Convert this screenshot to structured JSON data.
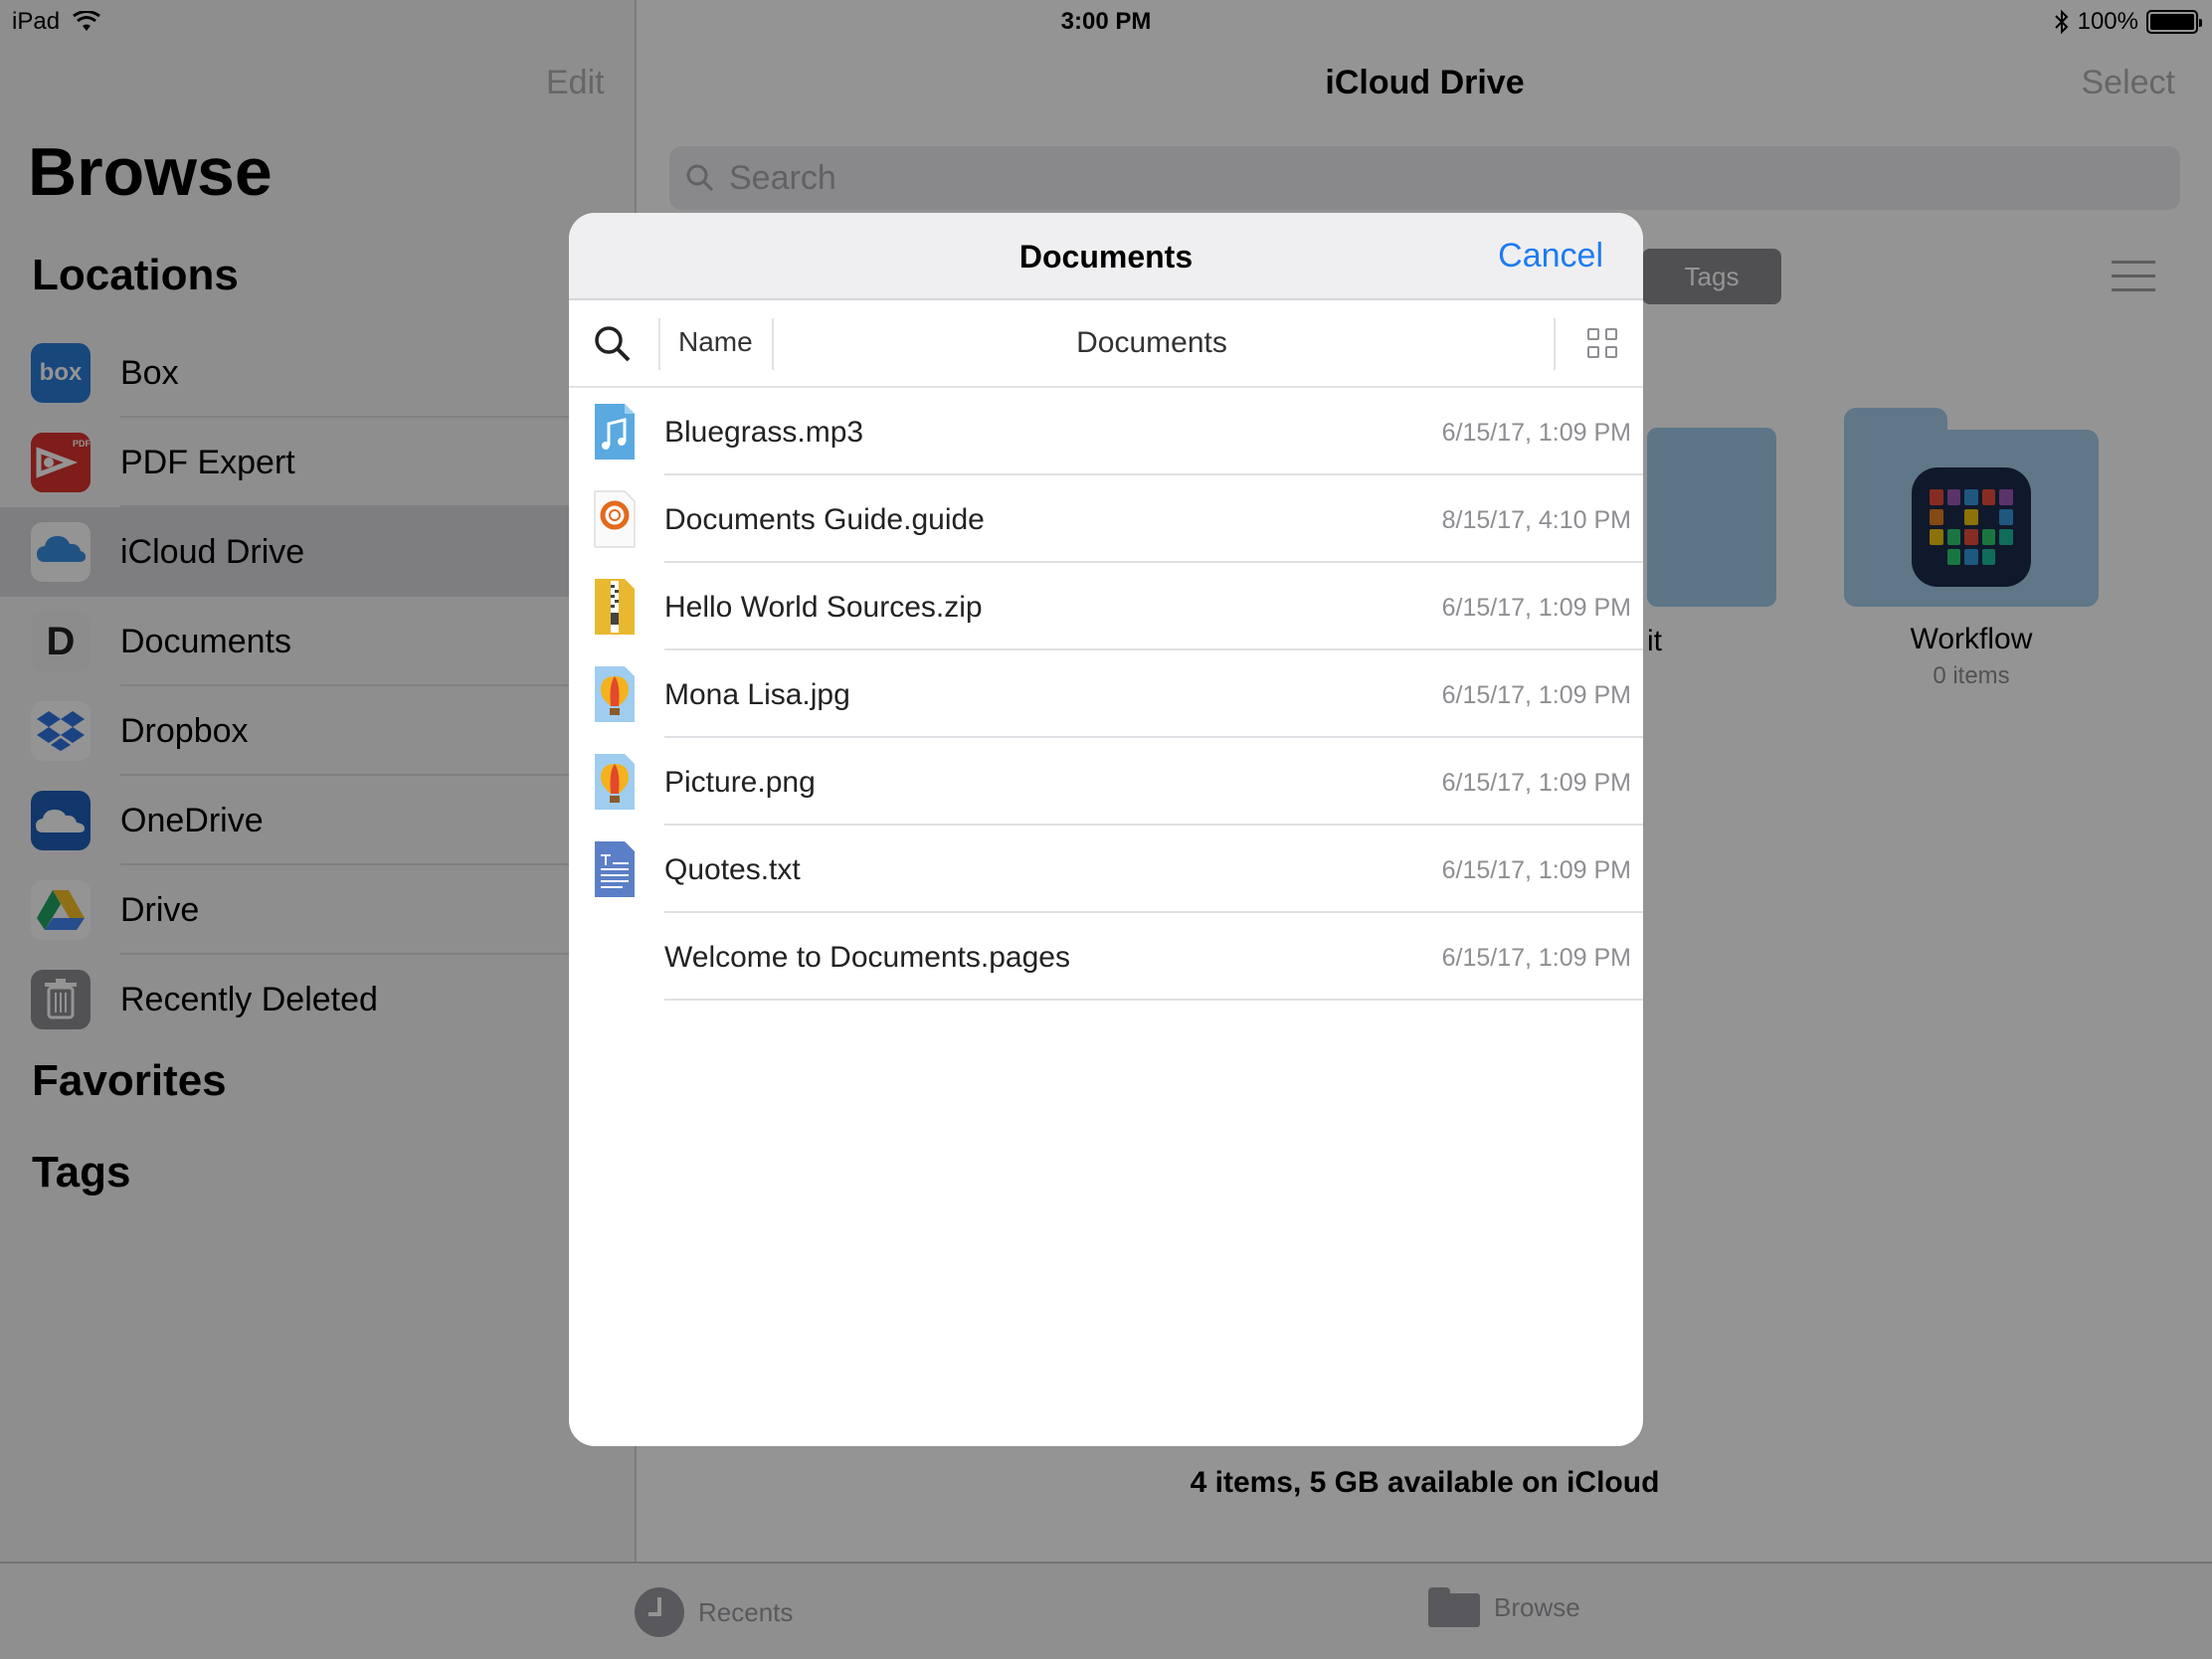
{
  "status_bar": {
    "device": "iPad",
    "time": "3:00 PM",
    "battery": "100%"
  },
  "sidebar": {
    "edit_label": "Edit",
    "title": "Browse",
    "locations_heading": "Locations",
    "locations": [
      {
        "label": "Box",
        "icon": "box-icon",
        "icon_text": "box",
        "color": "#2a7ad6"
      },
      {
        "label": "PDF Expert",
        "icon": "pdf-expert-icon",
        "icon_text": "PDF",
        "color": "#d9322c"
      },
      {
        "label": "iCloud Drive",
        "icon": "icloud-icon",
        "icon_text": "",
        "color": "#ffffff",
        "selected": true
      },
      {
        "label": "Documents",
        "icon": "documents-app-icon",
        "icon_text": "D",
        "color": "#ffffff"
      },
      {
        "label": "Dropbox",
        "icon": "dropbox-icon",
        "icon_text": "",
        "color": "#ffffff"
      },
      {
        "label": "OneDrive",
        "icon": "onedrive-icon",
        "icon_text": "",
        "color": "#1f60b8"
      },
      {
        "label": "Drive",
        "icon": "google-drive-icon",
        "icon_text": "",
        "color": "#ffffff"
      },
      {
        "label": "Recently Deleted",
        "icon": "trash-icon",
        "icon_text": "",
        "color": "#8e8e93"
      }
    ],
    "favorites_heading": "Favorites",
    "tags_heading": "Tags"
  },
  "main": {
    "title": "iCloud Drive",
    "select_label": "Select",
    "search_placeholder": "Search",
    "tags_chip": "Tags",
    "partial_folder_label": "it",
    "folder": {
      "name": "Workflow",
      "count": "0 items"
    },
    "storage_text": "4 items, 5 GB available on iCloud"
  },
  "tab_bar": {
    "recents_label": "Recents",
    "browse_label": "Browse"
  },
  "modal": {
    "title": "Documents",
    "cancel_label": "Cancel",
    "sort_label": "Name",
    "path_label": "Documents",
    "files": [
      {
        "name": "Bluegrass.mp3",
        "date": "6/15/17, 1:09 PM",
        "icon": "audio-file-icon"
      },
      {
        "name": "Documents Guide.guide",
        "date": "8/15/17, 4:10 PM",
        "icon": "guide-file-icon"
      },
      {
        "name": "Hello World Sources.zip",
        "date": "6/15/17, 1:09 PM",
        "icon": "zip-file-icon"
      },
      {
        "name": "Mona Lisa.jpg",
        "date": "6/15/17, 1:09 PM",
        "icon": "image-file-icon"
      },
      {
        "name": "Picture.png",
        "date": "6/15/17, 1:09 PM",
        "icon": "image-file-icon"
      },
      {
        "name": "Quotes.txt",
        "date": "6/15/17, 1:09 PM",
        "icon": "text-file-icon"
      },
      {
        "name": "Welcome to Documents.pages",
        "date": "6/15/17, 1:09 PM",
        "icon": ""
      }
    ]
  },
  "colors": {
    "accent": "#1e7cf2",
    "dim": "rgba(0,0,0,0.42)"
  }
}
